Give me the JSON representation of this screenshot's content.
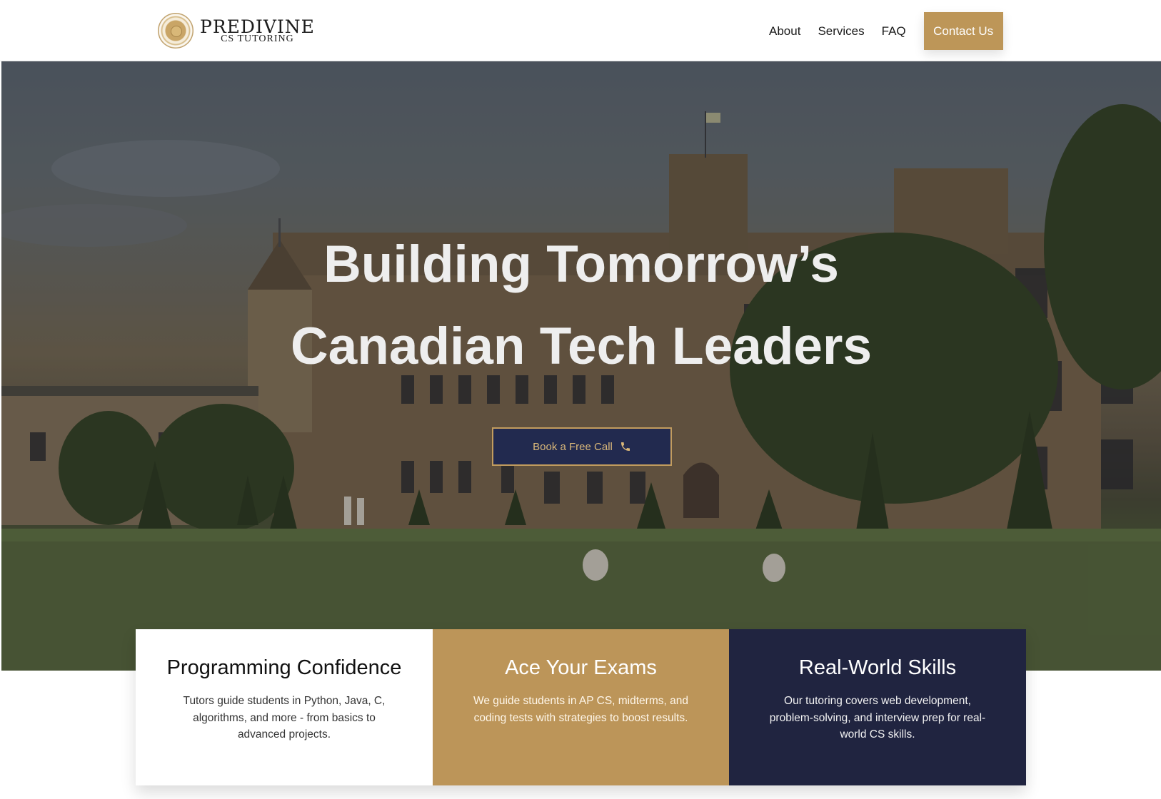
{
  "brand": {
    "name": "PREDIVINE",
    "tagline": "CS TUTORING"
  },
  "nav": {
    "links": [
      "About",
      "Services",
      "FAQ"
    ],
    "contact_label": "Contact Us"
  },
  "hero": {
    "title_line1": "Building Tomorrow’s",
    "title_line2": "Canadian Tech Leaders",
    "cta_label": "Book a Free Call",
    "cta_icon": "phone-icon"
  },
  "features": [
    {
      "title": "Programming Confidence",
      "text": "Tutors guide students in Python, Java, C, algorithms, and more - from basics to advanced projects."
    },
    {
      "title": "Ace Your Exams",
      "text": "We guide students in AP CS, midterms, and coding tests with strategies to boost results."
    },
    {
      "title": "Real-World Skills",
      "text": "Our tutoring covers web development, problem-solving, and interview prep for real-world CS skills."
    }
  ],
  "colors": {
    "gold": "#bd9658",
    "navy": "#202440",
    "hero_text": "#eeeeee"
  }
}
